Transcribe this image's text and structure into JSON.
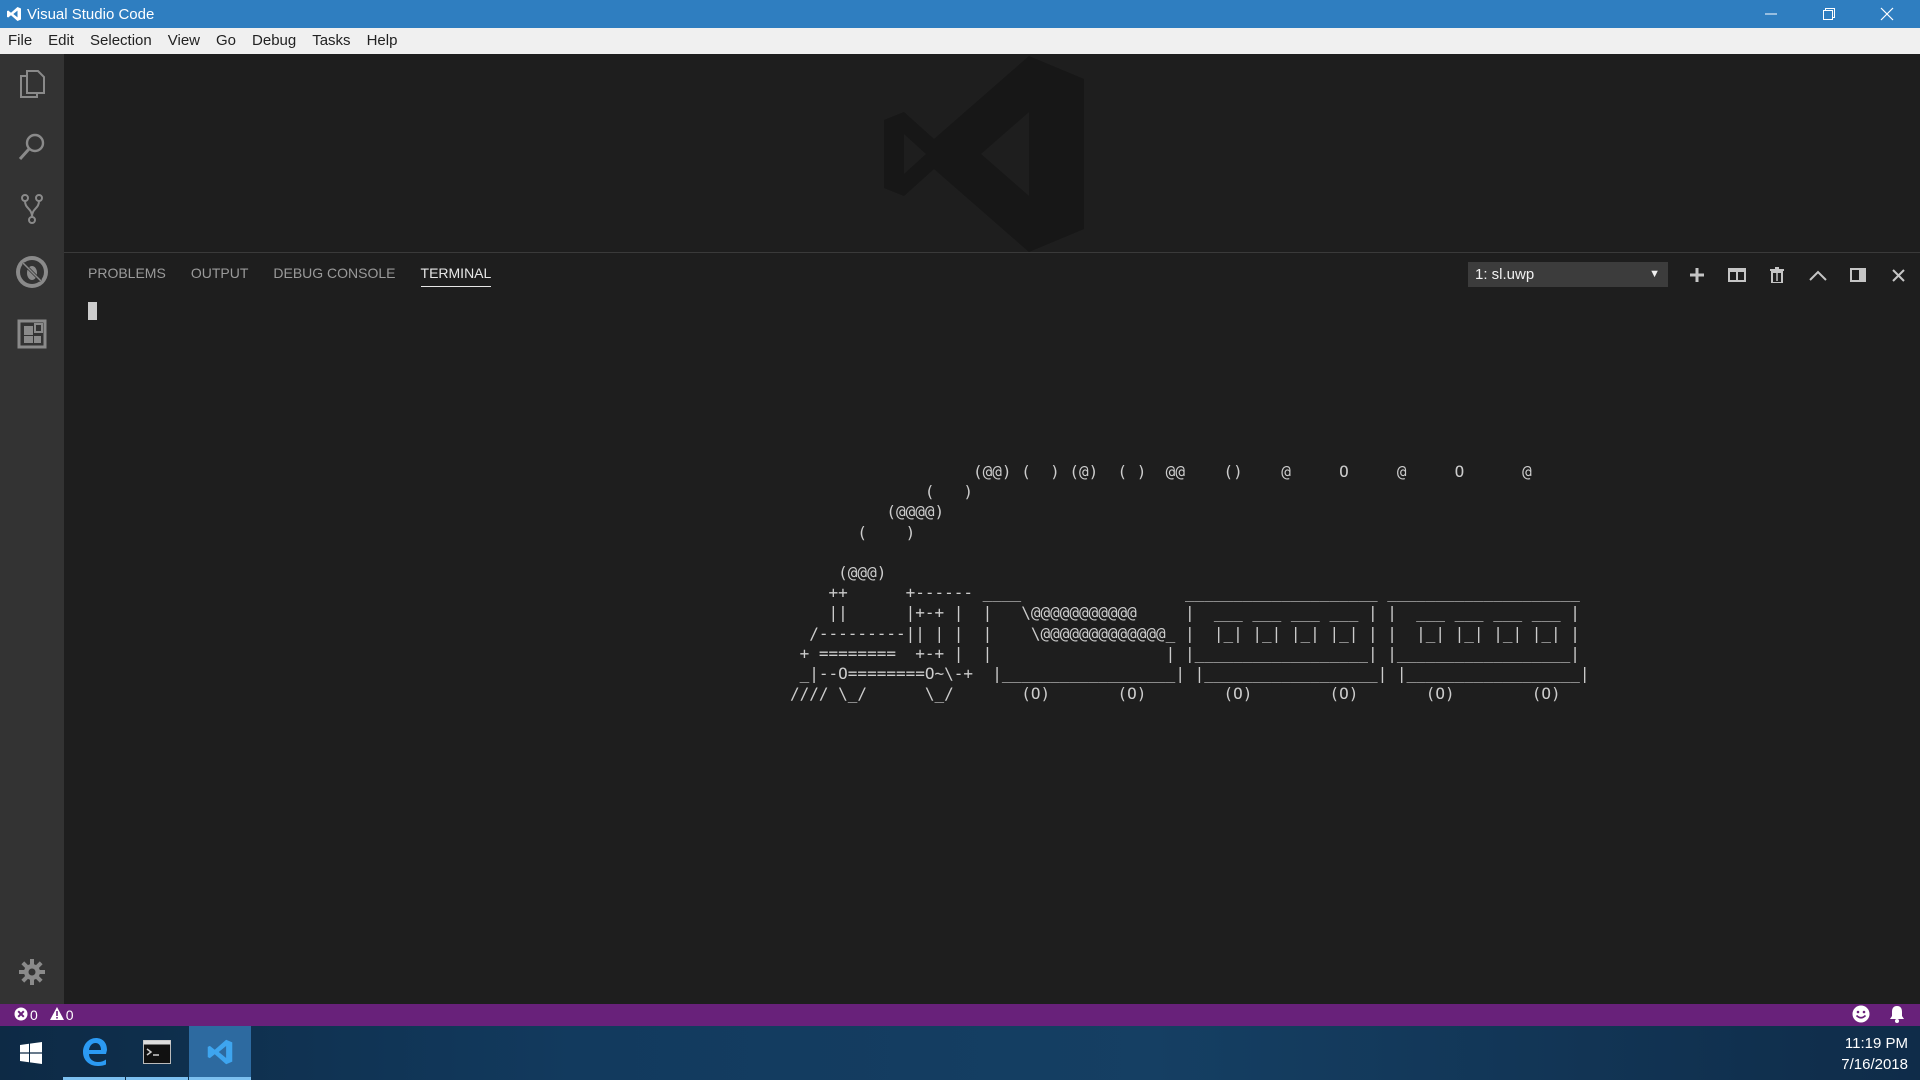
{
  "window": {
    "title": "Visual Studio Code",
    "titlebar_color": "#2f7ec0"
  },
  "menu": [
    "File",
    "Edit",
    "Selection",
    "View",
    "Go",
    "Debug",
    "Tasks",
    "Help"
  ],
  "activity_bar": {
    "icons": [
      "explorer-icon",
      "search-icon",
      "source-control-icon",
      "debug-icon",
      "extensions-icon"
    ],
    "bottom_icon": "gear-icon"
  },
  "panel": {
    "tabs": [
      "PROBLEMS",
      "OUTPUT",
      "DEBUG CONSOLE",
      "TERMINAL"
    ],
    "active_tab": "TERMINAL",
    "terminal_select": "1: sl.uwp",
    "terminal_output": "                   (@@) (  ) (@)  ( )  @@    ()    @     O     @     O      @\n              (   )\n          (@@@@)\n       (    )\n\n     (@@@)\n    ++      +------ ____                 ____________________ ____________________\n    ||      |+-+ |  |   \\@@@@@@@@@@@     |  ___ ___ ___ ___ | |  ___ ___ ___ ___ |\n  /---------|| | |  |    \\@@@@@@@@@@@@@_ |  |_| |_| |_| |_| | |  |_| |_| |_| |_| |\n + ========  +-+ |  |                  | |__________________| |__________________|\n _|--O========O~\\-+  |__________________| |__________________| |__________________|\n//// \\_/      \\_/       (O)       (O)        (O)        (O)       (O)        (O)"
  },
  "status_bar": {
    "errors": "0",
    "warnings": "0",
    "color": "#68217a"
  },
  "taskbar": {
    "apps": [
      "windows-start-icon",
      "edge-icon",
      "terminal-icon",
      "vscode-icon"
    ],
    "time": "11:19 PM",
    "date": "7/16/2018"
  }
}
